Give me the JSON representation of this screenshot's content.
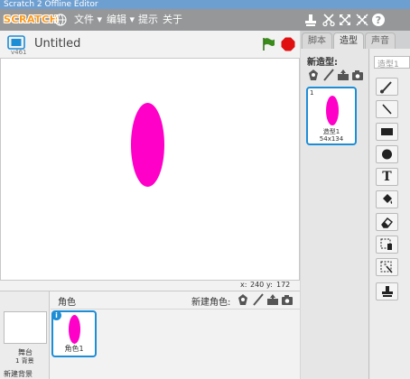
{
  "window": {
    "title": "Scratch 2 Offline Editor"
  },
  "menubar": {
    "logo": "SCRATCH",
    "items": [
      {
        "label": "文件"
      },
      {
        "label": "编辑"
      },
      {
        "label": "提示"
      },
      {
        "label": "关于"
      }
    ],
    "tool_icons": [
      "duplicate-stamp-icon",
      "cut-icon",
      "grow-icon",
      "shrink-icon",
      "help-icon"
    ]
  },
  "stage": {
    "project_title": "Untitled",
    "version": "v461",
    "coords": {
      "x_label": "x:",
      "x_value": "240",
      "y_label": "y:",
      "y_value": "172"
    },
    "sprite_color": "#ff00c8"
  },
  "sprites_panel": {
    "header_label": "角色",
    "new_sprite_label": "新建角色:",
    "stage_item": {
      "label": "舞台",
      "sub": "1 背景"
    },
    "new_backdrop_label": "新建背景",
    "sprites": [
      {
        "name": "角色1",
        "info": "i"
      }
    ]
  },
  "tabs": [
    {
      "label": "脚本",
      "active": false
    },
    {
      "label": "造型",
      "active": true
    },
    {
      "label": "声音",
      "active": false
    }
  ],
  "costumes": {
    "new_label": "新造型:",
    "items": [
      {
        "index": "1",
        "name": "造型1",
        "size": "54x134"
      }
    ]
  },
  "editor": {
    "costume_name_placeholder": "造型1",
    "tools": [
      "brush-icon",
      "line-icon",
      "rectangle-icon",
      "ellipse-icon",
      "text-icon",
      "fill-icon",
      "eraser-icon",
      "clone-select-icon",
      "magic-select-icon",
      "stamp-icon"
    ],
    "text_tool_glyph": "T"
  },
  "colors": {
    "accent": "#1d8dd6",
    "stop": "#e01010",
    "flag": "#3a8a1c",
    "menubar": "#959798"
  }
}
